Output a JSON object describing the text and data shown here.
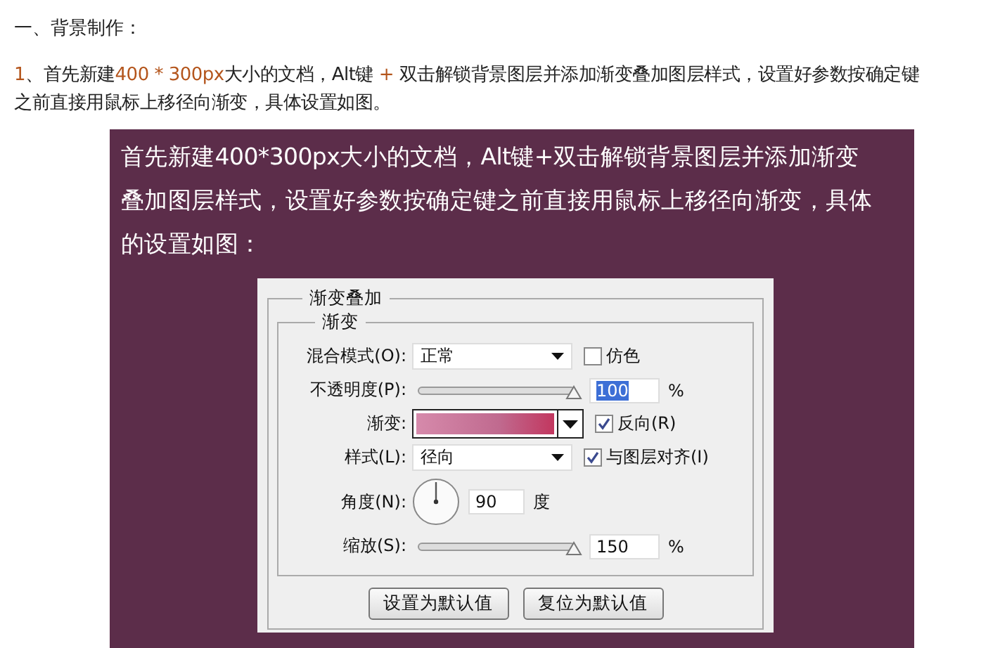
{
  "heading": "一、背景制作：",
  "intro": {
    "lines": [
      [
        {
          "text": "1",
          "highlight": true
        },
        {
          "text": "、首先新建",
          "highlight": false
        },
        {
          "text": "400 * 300px",
          "highlight": true
        },
        {
          "text": "大小的文档，",
          "highlight": false
        },
        {
          "text": "Alt",
          "highlight": false
        },
        {
          "text": "键 ",
          "highlight": false
        },
        {
          "text": "+",
          "highlight": true
        },
        {
          "text": " 双击解锁背景图层并添加渐变叠加图层样式，设置好参数按确定键",
          "highlight": false
        }
      ],
      [
        {
          "text": "之前直接用鼠标上移径向渐变，具体设置如图。",
          "highlight": false
        }
      ]
    ]
  },
  "screenshot": {
    "caption_lines": [
      "首先新建400*300px大小的文档，Alt键+双击解锁背景图层并添加渐变",
      "叠加图层样式，设置好参数按确定键之前直接用鼠标上移径向渐变，具体",
      "的设置如图："
    ],
    "dialog": {
      "group_title": "渐变叠加",
      "subgroup_title": "渐变",
      "rows": [
        {
          "kind": "select",
          "label": "混合模式(O):",
          "value": "正常",
          "option": {
            "label": "仿色",
            "checked": false
          }
        },
        {
          "kind": "slider",
          "label": "不透明度(P):",
          "level": 1,
          "value": "100",
          "value_selected": true,
          "unit": "%"
        },
        {
          "kind": "gradient",
          "label": "渐变:",
          "option": {
            "label": "反向(R)",
            "checked": true
          }
        },
        {
          "kind": "select",
          "label": "样式(L):",
          "value": "径向",
          "option": {
            "label": "与图层对齐(I)",
            "checked": true
          }
        },
        {
          "kind": "angle",
          "label": "角度(N):",
          "value": "90",
          "unit": "度"
        },
        {
          "kind": "slider",
          "label": "缩放(S):",
          "level": 1,
          "value": "150",
          "value_selected": false,
          "unit": "%"
        }
      ],
      "buttons": [
        "设置为默认值",
        "复位为默认值"
      ]
    }
  }
}
